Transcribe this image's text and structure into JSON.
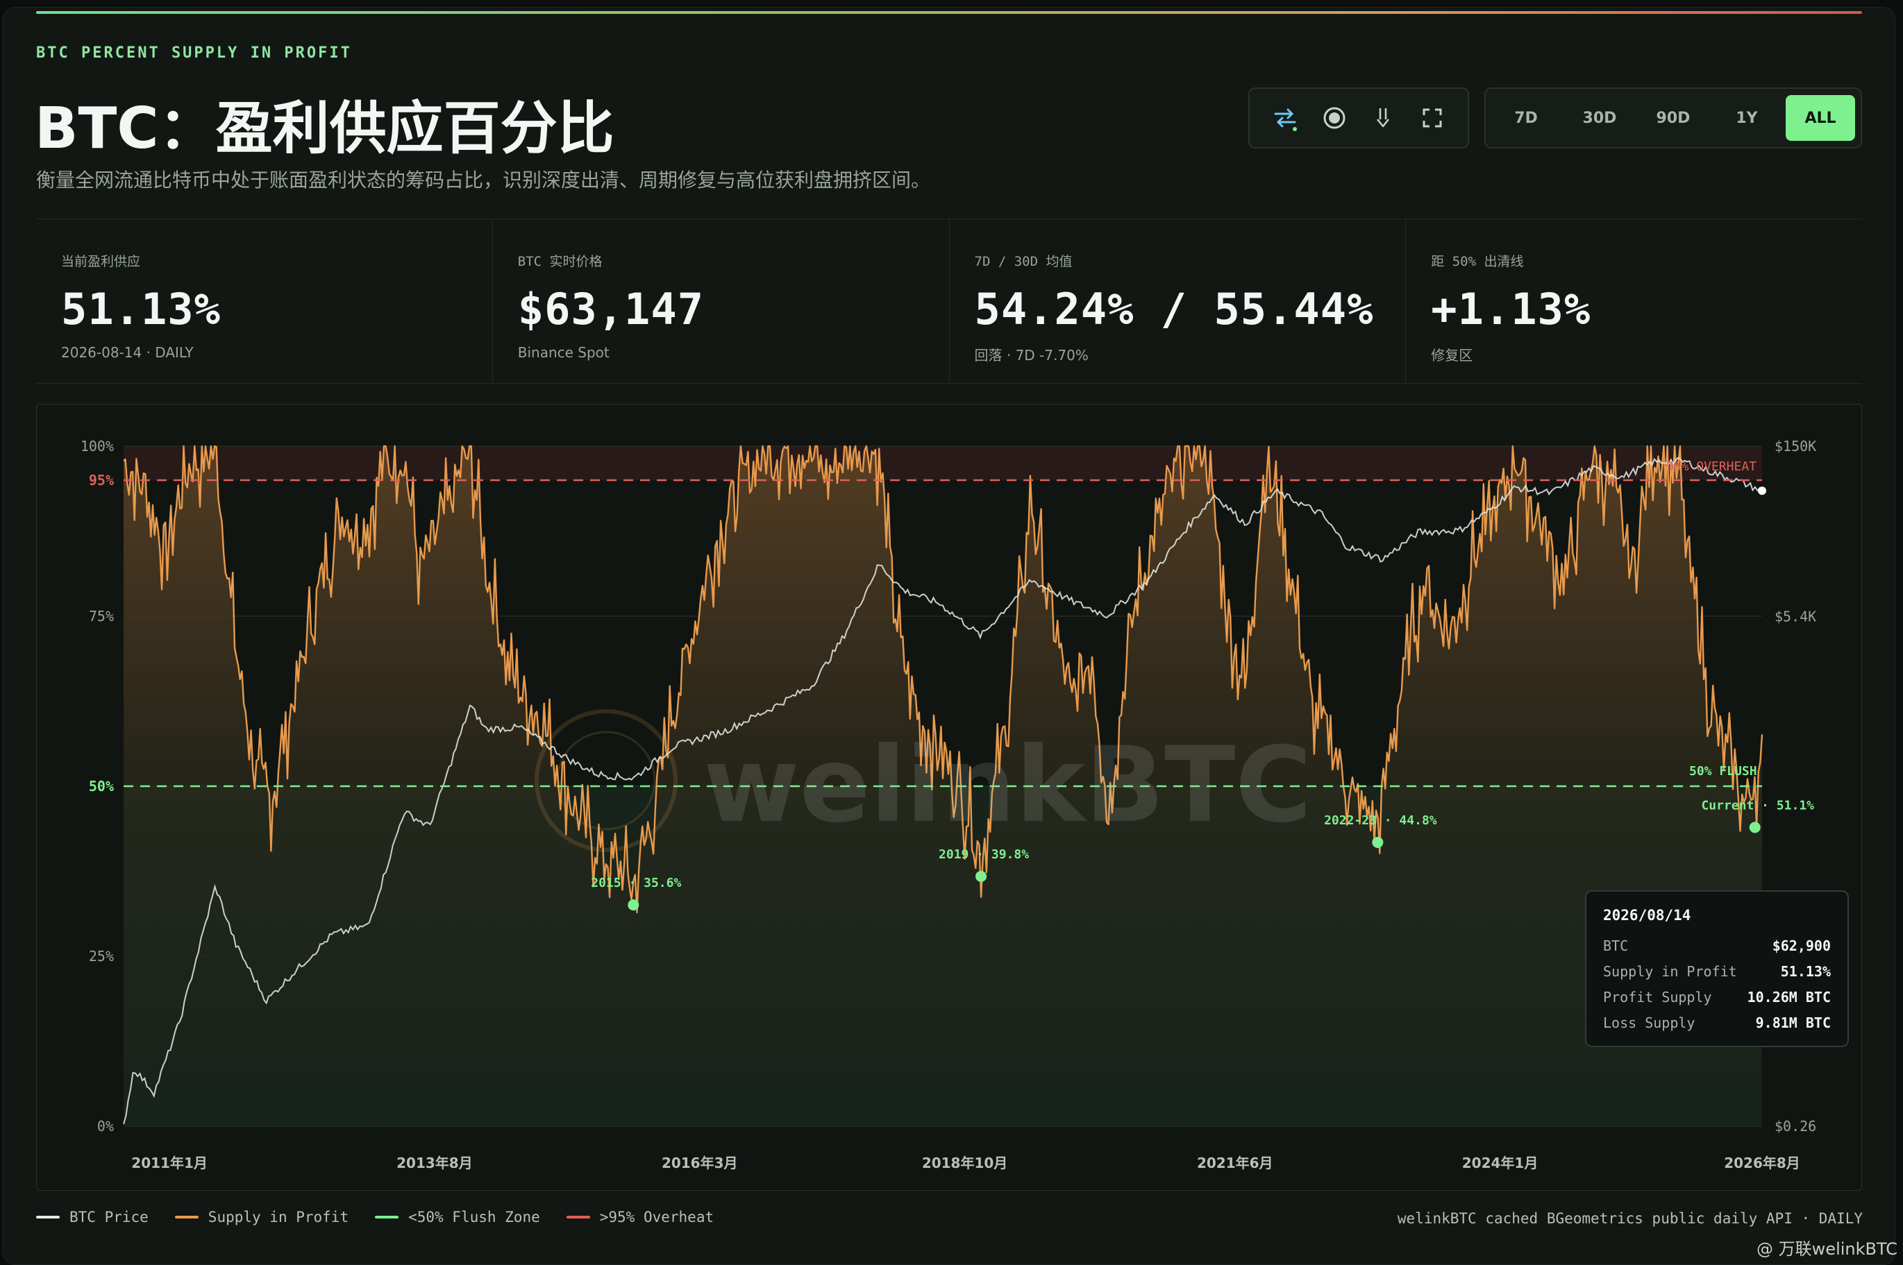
{
  "header": {
    "kicker": "BTC PERCENT SUPPLY IN PROFIT",
    "title": "BTC：盈利供应百分比",
    "subtitle": "衡量全网流通比特币中处于账面盈利状态的筹码占比，识别深度出清、周期修复与高位获利盘拥挤区间。"
  },
  "toolbar": {
    "tools": [
      "swap-icon",
      "record-icon",
      "download-icon",
      "fullscreen-icon"
    ]
  },
  "ranges": {
    "items": [
      "7D",
      "30D",
      "90D",
      "1Y",
      "ALL"
    ],
    "active": "ALL"
  },
  "stats": [
    {
      "label": "当前盈利供应",
      "value": "51.13%",
      "note": "2026-08-14 · DAILY"
    },
    {
      "label": "BTC 实时价格",
      "value": "$63,147",
      "note": "Binance Spot"
    },
    {
      "label": "7D / 30D 均值",
      "value": "54.24% / 55.44%",
      "note": "回落 · 7D -7.70%"
    },
    {
      "label": "距 50% 出清线",
      "value": "+1.13%",
      "note": "修复区"
    }
  ],
  "tooltip": {
    "date": "2026/08/14",
    "rows": [
      {
        "k": "BTC",
        "v": "$62,900"
      },
      {
        "k": "Supply in Profit",
        "v": "51.13%"
      },
      {
        "k": "Profit Supply",
        "v": "10.26M BTC"
      },
      {
        "k": "Loss Supply",
        "v": "9.81M BTC"
      }
    ]
  },
  "legend": [
    {
      "name": "BTC Price",
      "color": "#e6e9e6"
    },
    {
      "name": "Supply in Profit",
      "color": "#e89a4c"
    },
    {
      "name": "<50% Flush Zone",
      "color": "#7ef08d"
    },
    {
      "name": ">95% Overheat",
      "color": "#e0605a"
    }
  ],
  "source": "welinkBTC cached BGeometrics public daily API · DAILY",
  "credit": "@ 万联welinkBTC",
  "watermark": "welinkBTC",
  "colors": {
    "supply": "#e89a4c",
    "price": "#dfe3df",
    "flush": "#7ef08d",
    "overheat": "#e0605a"
  },
  "chart_data": {
    "type": "line",
    "x_range": [
      "2010-07",
      "2026-08"
    ],
    "x_ticks": [
      {
        "label": "2011年1月",
        "t": 2011.0
      },
      {
        "label": "2013年8月",
        "t": 2013.6
      },
      {
        "label": "2016年3月",
        "t": 2016.2
      },
      {
        "label": "2018年10月",
        "t": 2018.8
      },
      {
        "label": "2021年6月",
        "t": 2021.45
      },
      {
        "label": "2024年1月",
        "t": 2024.05
      },
      {
        "label": "2026年8月",
        "t": 2026.62
      }
    ],
    "y_left": {
      "ticks": [
        "0%",
        "25%",
        "50%",
        "75%",
        "95%",
        "100%"
      ],
      "values": [
        0,
        25,
        50,
        75,
        95,
        100
      ],
      "range": [
        0,
        100
      ]
    },
    "y_right": {
      "ticks": [
        "$0.26",
        "$5.4K",
        "$150K"
      ],
      "values": [
        0.26,
        5400,
        150000
      ],
      "scale": "log"
    },
    "thresholds": [
      {
        "value": 95,
        "label": "95% OVERHEAT",
        "axis_label": "95%"
      },
      {
        "value": 50,
        "label": "50% FLUSH",
        "axis_label": "50%"
      }
    ],
    "series": [
      {
        "name": "Supply in Profit",
        "axis": "left",
        "points": [
          [
            2010.55,
            98
          ],
          [
            2010.75,
            94
          ],
          [
            2010.95,
            85
          ],
          [
            2011.2,
            97
          ],
          [
            2011.45,
            99
          ],
          [
            2011.65,
            70
          ],
          [
            2011.85,
            52
          ],
          [
            2012.0,
            48
          ],
          [
            2012.2,
            62
          ],
          [
            2012.45,
            78
          ],
          [
            2012.7,
            90
          ],
          [
            2012.9,
            87
          ],
          [
            2013.1,
            97
          ],
          [
            2013.3,
            99
          ],
          [
            2013.45,
            82
          ],
          [
            2013.7,
            90
          ],
          [
            2013.95,
            100
          ],
          [
            2014.1,
            82
          ],
          [
            2014.35,
            66
          ],
          [
            2014.6,
            61
          ],
          [
            2014.85,
            52
          ],
          [
            2015.05,
            44
          ],
          [
            2015.25,
            40
          ],
          [
            2015.4,
            38
          ],
          [
            2015.55,
            35.6
          ],
          [
            2015.75,
            46
          ],
          [
            2015.95,
            62
          ],
          [
            2016.15,
            74
          ],
          [
            2016.4,
            88
          ],
          [
            2016.65,
            96
          ],
          [
            2016.9,
            99
          ],
          [
            2017.2,
            100
          ],
          [
            2017.45,
            96
          ],
          [
            2017.75,
            100
          ],
          [
            2017.95,
            99
          ],
          [
            2018.15,
            72
          ],
          [
            2018.35,
            60
          ],
          [
            2018.6,
            55
          ],
          [
            2018.85,
            45
          ],
          [
            2018.96,
            39.8
          ],
          [
            2019.2,
            58
          ],
          [
            2019.45,
            92
          ],
          [
            2019.65,
            75
          ],
          [
            2019.85,
            62
          ],
          [
            2020.05,
            70
          ],
          [
            2020.2,
            46
          ],
          [
            2020.45,
            75
          ],
          [
            2020.75,
            92
          ],
          [
            2020.95,
            99
          ],
          [
            2021.15,
            100
          ],
          [
            2021.4,
            74
          ],
          [
            2021.55,
            64
          ],
          [
            2021.75,
            99
          ],
          [
            2021.95,
            85
          ],
          [
            2022.2,
            62
          ],
          [
            2022.4,
            56
          ],
          [
            2022.6,
            48
          ],
          [
            2022.85,
            44.8
          ],
          [
            2023.05,
            62
          ],
          [
            2023.3,
            80
          ],
          [
            2023.55,
            72
          ],
          [
            2023.8,
            84
          ],
          [
            2024.0,
            90
          ],
          [
            2024.2,
            99
          ],
          [
            2024.45,
            88
          ],
          [
            2024.7,
            80
          ],
          [
            2024.95,
            99
          ],
          [
            2025.15,
            94
          ],
          [
            2025.35,
            82
          ],
          [
            2025.55,
            99
          ],
          [
            2025.8,
            96
          ],
          [
            2025.95,
            78
          ],
          [
            2026.1,
            62
          ],
          [
            2026.3,
            54
          ],
          [
            2026.45,
            47
          ],
          [
            2026.55,
            52
          ],
          [
            2026.62,
            51.13
          ]
        ],
        "annotations": [
          {
            "t": 2015.55,
            "value": 35.6,
            "label": "2015 · 35.6%"
          },
          {
            "t": 2018.96,
            "value": 39.8,
            "label": "2019 · 39.8%"
          },
          {
            "t": 2022.85,
            "value": 44.8,
            "label": "2022-23 · 44.8%"
          },
          {
            "t": 2026.55,
            "value": 47.0,
            "label": "Current · 51.1%"
          }
        ]
      },
      {
        "name": "BTC Price",
        "axis": "right",
        "points": [
          [
            2010.55,
            0.26
          ],
          [
            2010.65,
            0.8
          ],
          [
            2010.85,
            0.5
          ],
          [
            2011.1,
            2
          ],
          [
            2011.45,
            28
          ],
          [
            2011.65,
            9
          ],
          [
            2011.95,
            3
          ],
          [
            2012.2,
            5
          ],
          [
            2012.6,
            11
          ],
          [
            2012.95,
            13
          ],
          [
            2013.3,
            120
          ],
          [
            2013.55,
            90
          ],
          [
            2013.95,
            950
          ],
          [
            2014.1,
            600
          ],
          [
            2014.45,
            620
          ],
          [
            2014.95,
            320
          ],
          [
            2015.2,
            250
          ],
          [
            2015.55,
            230
          ],
          [
            2015.95,
            430
          ],
          [
            2016.45,
            580
          ],
          [
            2016.9,
            900
          ],
          [
            2017.3,
            1400
          ],
          [
            2017.6,
            3500
          ],
          [
            2017.96,
            15000
          ],
          [
            2018.2,
            9000
          ],
          [
            2018.55,
            7000
          ],
          [
            2018.96,
            3700
          ],
          [
            2019.45,
            11000
          ],
          [
            2019.85,
            7300
          ],
          [
            2020.2,
            5500
          ],
          [
            2020.6,
            11000
          ],
          [
            2020.96,
            29000
          ],
          [
            2021.25,
            58000
          ],
          [
            2021.55,
            33000
          ],
          [
            2021.85,
            62000
          ],
          [
            2022.3,
            40000
          ],
          [
            2022.55,
            21000
          ],
          [
            2022.9,
            16500
          ],
          [
            2023.25,
            28000
          ],
          [
            2023.65,
            29000
          ],
          [
            2023.95,
            43000
          ],
          [
            2024.2,
            67000
          ],
          [
            2024.55,
            60000
          ],
          [
            2024.95,
            97000
          ],
          [
            2025.25,
            82000
          ],
          [
            2025.55,
            110000
          ],
          [
            2025.85,
            112000
          ],
          [
            2026.1,
            92000
          ],
          [
            2026.4,
            75000
          ],
          [
            2026.62,
            62900
          ]
        ]
      }
    ]
  }
}
